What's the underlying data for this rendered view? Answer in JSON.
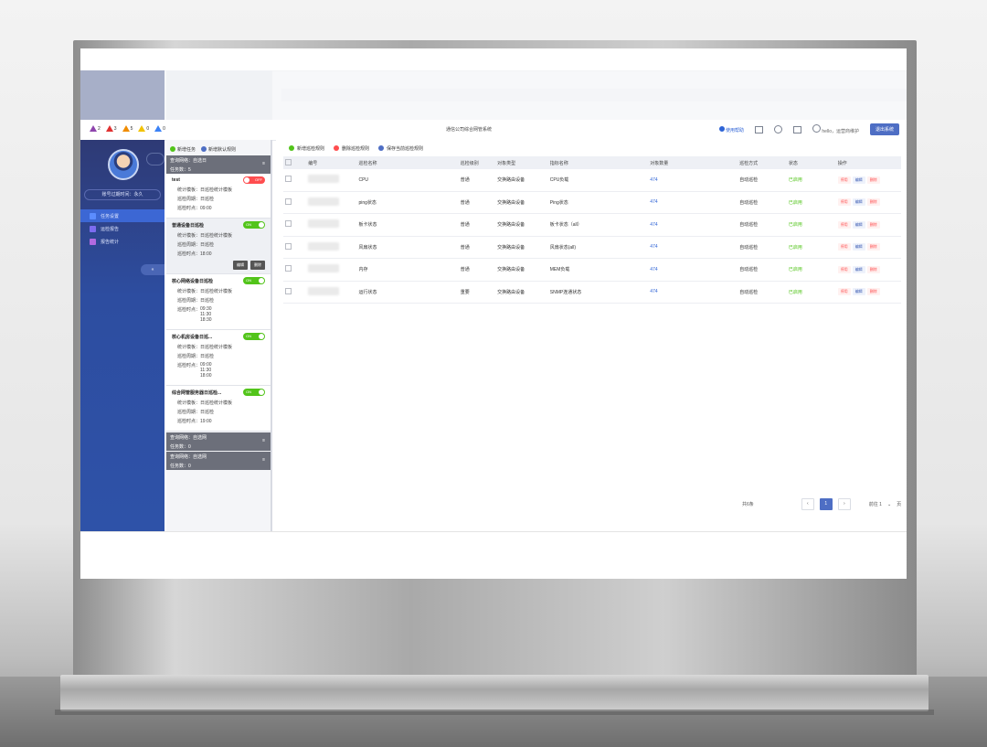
{
  "topbar": {
    "alarms": [
      {
        "color": "#8e44ad",
        "count": "2"
      },
      {
        "color": "#e03131",
        "count": "3"
      },
      {
        "color": "#f08c00",
        "count": "5"
      },
      {
        "color": "#f2c200",
        "count": "0"
      },
      {
        "color": "#3b82f6",
        "count": "0"
      }
    ],
    "title": "通信公司综合网管系统",
    "help": "使用帮助",
    "user": "hello，运营商维护",
    "logout": "退出系统"
  },
  "sidebar": {
    "user_id": "账号过期时间：永久",
    "collapse": "«",
    "nav": [
      {
        "label": "任务设置",
        "icon_color": "#5b8cff",
        "active": true
      },
      {
        "label": "运检报告",
        "icon_color": "#7c6cf0",
        "active": false
      },
      {
        "label": "报告统计",
        "icon_color": "#b26ae0",
        "active": false
      }
    ]
  },
  "panel": {
    "buttons": [
      {
        "label": "新增任务",
        "color": "#52c41a"
      },
      {
        "label": "新增默认规则",
        "color": "#4e6ec4"
      }
    ],
    "group_top": {
      "name": "查询网络：自选日",
      "count": "任务数：5"
    },
    "tasks": [
      {
        "name": "test",
        "toggle": "OFF",
        "stat": "统计模板：日巡检统计模板",
        "cycle": "巡检周期：日巡检",
        "times": [
          "巡检时点：09:00"
        ],
        "selected": false
      },
      {
        "name": "普通设备日巡检",
        "toggle": "ON",
        "stat": "统计模板：日巡检统计模板",
        "cycle": "巡检周期：日巡检",
        "times": [
          "巡检时点：18:00"
        ],
        "selected": true,
        "actions": [
          "编辑",
          "删除"
        ]
      },
      {
        "name": "核心网络设备日巡检",
        "toggle": "ON",
        "stat": "统计模板：日巡检统计模板",
        "cycle": "巡检周期：日巡检",
        "times": [
          "巡检时点：",
          "09:30",
          "11:30",
          "18:30"
        ],
        "selected": false
      },
      {
        "name": "核心机房设备日巡...",
        "toggle": "ON",
        "stat": "统计模板：日巡检统计模板",
        "cycle": "巡检周期：日巡检",
        "times": [
          "巡检时点：",
          "09:00",
          "11:30",
          "18:00"
        ],
        "selected": false
      },
      {
        "name": "综合网管服务器日巡检...",
        "toggle": "ON",
        "stat": "统计模板：日巡检统计模板",
        "cycle": "巡检周期：日巡检",
        "times": [
          "巡检时点：19:00"
        ],
        "selected": false
      }
    ],
    "groups_bottom": [
      {
        "name": "查询网络：自选网",
        "count": "任务数：0"
      },
      {
        "name": "查询网络：自选网",
        "count": "任务数：0"
      }
    ]
  },
  "main": {
    "toolbar": [
      {
        "label": "新增巡检规则",
        "color": "#52c41a"
      },
      {
        "label": "删除巡检规则",
        "color": "#ff4d4f"
      },
      {
        "label": "保存当前巡检规则",
        "color": "#4e6ec4"
      }
    ],
    "columns": [
      "编号",
      "巡检名称",
      "巡检级别",
      "对象类型",
      "指标名称",
      "对象数量",
      "巡检方式",
      "状态",
      "操作"
    ],
    "rows": [
      {
        "name": "CPU",
        "level": "普通",
        "type": "交换路由设备",
        "metric": "CPU负载",
        "count": "474",
        "mode": "自动巡检",
        "status": "已启用"
      },
      {
        "name": "ping状态",
        "level": "普通",
        "type": "交换路由设备",
        "metric": "Ping状态",
        "count": "474",
        "mode": "自动巡检",
        "status": "已启用"
      },
      {
        "name": "板卡状态",
        "level": "普通",
        "type": "交换路由设备",
        "metric": "板卡状态（all）",
        "count": "474",
        "mode": "自动巡检",
        "status": "已启用"
      },
      {
        "name": "风扇状态",
        "level": "普通",
        "type": "交换路由设备",
        "metric": "风扇状态(all)",
        "count": "474",
        "mode": "自动巡检",
        "status": "已启用"
      },
      {
        "name": "内存",
        "level": "普通",
        "type": "交换路由设备",
        "metric": "MEM负载",
        "count": "474",
        "mode": "自动巡检",
        "status": "已启用"
      },
      {
        "name": "运行状态",
        "level": "重要",
        "type": "交换路由设备",
        "metric": "SNMP连通状态",
        "count": "474",
        "mode": "自动巡检",
        "status": "已启用"
      }
    ],
    "ops": [
      "停用",
      "编辑",
      "删除"
    ],
    "pager": {
      "total": "共6条",
      "prev": "‹",
      "page": "1",
      "next": "›",
      "jump": "前往 1",
      "unit": "页"
    }
  }
}
